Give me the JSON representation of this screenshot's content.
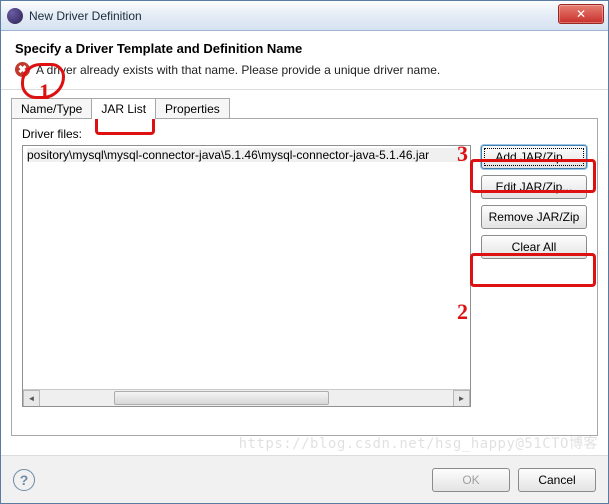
{
  "titlebar": {
    "title": "New Driver Definition",
    "close_glyph": "✕"
  },
  "banner": {
    "heading": "Specify a Driver Template and Definition Name",
    "error_glyph": "✖",
    "error_msg": "A driver already exists with that name. Please provide a unique driver name."
  },
  "tabs": {
    "name_type": "Name/Type",
    "jar_list": "JAR List",
    "properties": "Properties"
  },
  "jar": {
    "label": "Driver files:",
    "items": [
      "pository\\mysql\\mysql-connector-java\\5.1.46\\mysql-connector-java-5.1.46.jar"
    ]
  },
  "buttons": {
    "add_jar": "Add JAR/Zip...",
    "edit_jar": "Edit JAR/Zip...",
    "remove_jar": "Remove JAR/Zip",
    "clear_all": "Clear All",
    "ok": "OK",
    "cancel": "Cancel",
    "help_glyph": "?"
  },
  "scroll": {
    "left_glyph": "◄",
    "right_glyph": "►"
  },
  "annotations": {
    "n1": "1",
    "n2": "2",
    "n3": "3"
  },
  "watermark": "https://blog.csdn.net/hsg_happy@51CTO博客"
}
